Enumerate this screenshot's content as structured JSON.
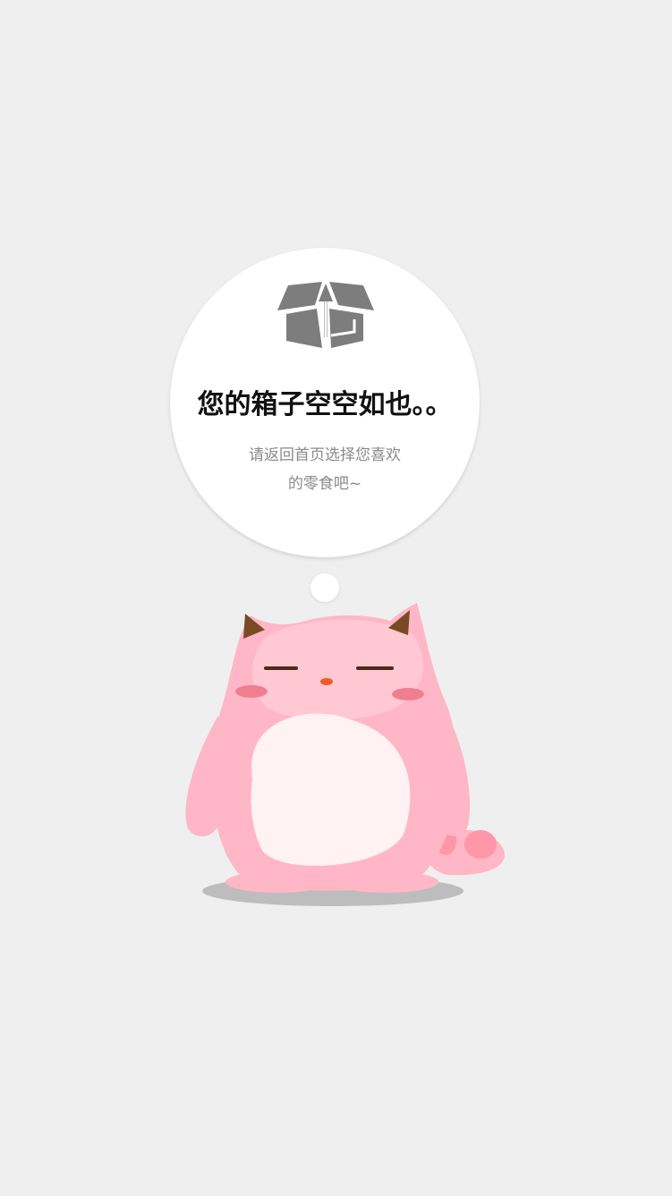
{
  "empty_state": {
    "title": "您的箱子空空如也。。",
    "hint_line1": "请返回首页选择您喜欢",
    "hint_line2": "的零食吧~",
    "icon": "open-box-icon",
    "illustration": "pink-cat-illustration"
  },
  "colors": {
    "background": "#efefef",
    "bubble": "#ffffff",
    "icon": "#7d7d7d",
    "title": "#111111",
    "hint": "#8a8a8a",
    "cat_body": "#ffb6c6",
    "cat_face": "#ffc8d2",
    "cat_belly": "#fff2f3",
    "cat_ear_inner": "#7a4a24",
    "cat_cheek": "#ef7f90",
    "cat_nose": "#f25a2b"
  }
}
